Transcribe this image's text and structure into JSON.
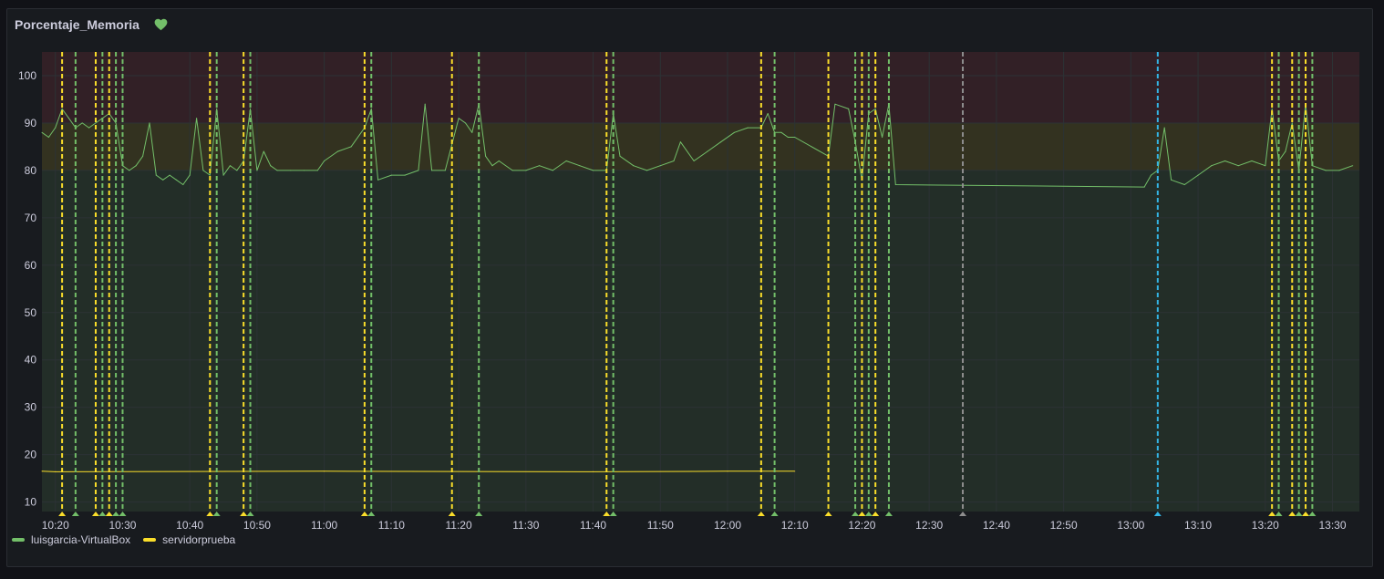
{
  "panel": {
    "title": "Porcentaje_Memoria",
    "health_icon": "heart-icon",
    "health_color": "#73bf69"
  },
  "colors": {
    "background": "#181b1f",
    "grid": "#2c3235",
    "text": "#ccccdc",
    "threshold_green": "#73bf69",
    "threshold_yellow": "#fade2a",
    "threshold_red": "#f2495c",
    "annotation_gray": "#8e8e8e",
    "annotation_blue": "#33b5e5"
  },
  "chart_data": {
    "type": "line",
    "title": "",
    "xlabel": "",
    "ylabel": "",
    "ylim": [
      8,
      105
    ],
    "yticks": [
      10,
      20,
      30,
      40,
      50,
      60,
      70,
      80,
      90,
      100
    ],
    "xlim": [
      "10:18",
      "13:34"
    ],
    "xticks": [
      "10:20",
      "10:30",
      "10:40",
      "10:50",
      "11:00",
      "11:10",
      "11:20",
      "11:30",
      "11:40",
      "11:50",
      "12:00",
      "12:10",
      "12:20",
      "12:30",
      "12:40",
      "12:50",
      "13:00",
      "13:10",
      "13:20",
      "13:30"
    ],
    "grid": true,
    "legend_position": "bottom-left",
    "thresholds": [
      {
        "from": 0,
        "to": 80,
        "color": "#73bf69"
      },
      {
        "from": 80,
        "to": 90,
        "color": "#fade2a"
      },
      {
        "from": 90,
        "to": 105,
        "color": "#f2495c"
      }
    ],
    "series": [
      {
        "name": "luisgarcia-VirtualBox",
        "color": "#73bf69",
        "points": [
          [
            "10:18",
            88
          ],
          [
            "10:19",
            87
          ],
          [
            "10:20",
            89
          ],
          [
            "10:21",
            93
          ],
          [
            "10:22",
            91
          ],
          [
            "10:23",
            89
          ],
          [
            "10:24",
            90
          ],
          [
            "10:25",
            89
          ],
          [
            "10:26",
            90
          ],
          [
            "10:27",
            91
          ],
          [
            "10:28",
            92
          ],
          [
            "10:29",
            90
          ],
          [
            "10:30",
            81
          ],
          [
            "10:31",
            80
          ],
          [
            "10:32",
            81
          ],
          [
            "10:33",
            83
          ],
          [
            "10:34",
            90
          ],
          [
            "10:35",
            79
          ],
          [
            "10:36",
            78
          ],
          [
            "10:37",
            79
          ],
          [
            "10:38",
            78
          ],
          [
            "10:39",
            77
          ],
          [
            "10:40",
            79
          ],
          [
            "10:41",
            91
          ],
          [
            "10:42",
            80
          ],
          [
            "10:43",
            79
          ],
          [
            "10:44",
            93
          ],
          [
            "10:45",
            79
          ],
          [
            "10:46",
            81
          ],
          [
            "10:47",
            80
          ],
          [
            "10:48",
            82
          ],
          [
            "10:49",
            93
          ],
          [
            "10:50",
            80
          ],
          [
            "10:51",
            84
          ],
          [
            "10:52",
            81
          ],
          [
            "10:53",
            80
          ],
          [
            "10:55",
            80
          ],
          [
            "10:57",
            80
          ],
          [
            "10:59",
            80
          ],
          [
            "11:00",
            82
          ],
          [
            "11:02",
            84
          ],
          [
            "11:04",
            85
          ],
          [
            "11:06",
            89
          ],
          [
            "11:07",
            93
          ],
          [
            "11:08",
            78
          ],
          [
            "11:10",
            79
          ],
          [
            "11:12",
            79
          ],
          [
            "11:14",
            80
          ],
          [
            "11:15",
            94
          ],
          [
            "11:16",
            80
          ],
          [
            "11:18",
            80
          ],
          [
            "11:20",
            91
          ],
          [
            "11:21",
            90
          ],
          [
            "11:22",
            88
          ],
          [
            "11:23",
            94
          ],
          [
            "11:24",
            83
          ],
          [
            "11:25",
            81
          ],
          [
            "11:26",
            82
          ],
          [
            "11:28",
            80
          ],
          [
            "11:30",
            80
          ],
          [
            "11:32",
            81
          ],
          [
            "11:34",
            80
          ],
          [
            "11:36",
            82
          ],
          [
            "11:38",
            81
          ],
          [
            "11:40",
            80
          ],
          [
            "11:42",
            80
          ],
          [
            "11:43",
            92
          ],
          [
            "11:44",
            83
          ],
          [
            "11:46",
            81
          ],
          [
            "11:48",
            80
          ],
          [
            "11:50",
            81
          ],
          [
            "11:52",
            82
          ],
          [
            "11:53",
            86
          ],
          [
            "11:55",
            82
          ],
          [
            "11:57",
            84
          ],
          [
            "11:59",
            86
          ],
          [
            "12:01",
            88
          ],
          [
            "12:03",
            89
          ],
          [
            "12:05",
            89
          ],
          [
            "12:06",
            92
          ],
          [
            "12:07",
            88
          ],
          [
            "12:08",
            88
          ],
          [
            "12:09",
            87
          ],
          [
            "12:10",
            87
          ],
          [
            "12:15",
            83
          ],
          [
            "12:16",
            94
          ],
          [
            "12:18",
            93
          ],
          [
            "12:19",
            86
          ],
          [
            "12:20",
            78
          ],
          [
            "12:21",
            92
          ],
          [
            "12:22",
            93
          ],
          [
            "12:23",
            87
          ],
          [
            "12:24",
            94
          ],
          [
            "12:25",
            77
          ],
          [
            "13:02",
            76.5
          ],
          [
            "13:03",
            79
          ],
          [
            "13:04",
            80
          ],
          [
            "13:05",
            89
          ],
          [
            "13:06",
            78
          ],
          [
            "13:08",
            77
          ],
          [
            "13:10",
            79
          ],
          [
            "13:12",
            81
          ],
          [
            "13:14",
            82
          ],
          [
            "13:16",
            81
          ],
          [
            "13:18",
            82
          ],
          [
            "13:20",
            81
          ],
          [
            "13:21",
            93
          ],
          [
            "13:22",
            82
          ],
          [
            "13:23",
            84
          ],
          [
            "13:24",
            90
          ],
          [
            "13:25",
            80
          ],
          [
            "13:26",
            94
          ],
          [
            "13:27",
            81
          ],
          [
            "13:29",
            80
          ],
          [
            "13:31",
            80
          ],
          [
            "13:33",
            81
          ]
        ]
      },
      {
        "name": "servidorprueba",
        "color": "#fade2a",
        "points": [
          [
            "10:18",
            16.5
          ],
          [
            "10:20",
            16.4
          ],
          [
            "11:00",
            16.5
          ],
          [
            "11:40",
            16.4
          ],
          [
            "12:00",
            16.5
          ],
          [
            "12:10",
            16.5
          ]
        ]
      }
    ],
    "annotations": [
      {
        "time": "10:21",
        "color": "#fade2a"
      },
      {
        "time": "10:23",
        "color": "#73bf69"
      },
      {
        "time": "10:26",
        "color": "#fade2a"
      },
      {
        "time": "10:27",
        "color": "#73bf69"
      },
      {
        "time": "10:28",
        "color": "#fade2a"
      },
      {
        "time": "10:29",
        "color": "#73bf69"
      },
      {
        "time": "10:30",
        "color": "#73bf69"
      },
      {
        "time": "10:43",
        "color": "#fade2a"
      },
      {
        "time": "10:44",
        "color": "#73bf69"
      },
      {
        "time": "10:48",
        "color": "#fade2a"
      },
      {
        "time": "10:49",
        "color": "#73bf69"
      },
      {
        "time": "11:06",
        "color": "#fade2a"
      },
      {
        "time": "11:07",
        "color": "#73bf69"
      },
      {
        "time": "11:19",
        "color": "#fade2a"
      },
      {
        "time": "11:23",
        "color": "#73bf69"
      },
      {
        "time": "11:42",
        "color": "#fade2a"
      },
      {
        "time": "11:43",
        "color": "#73bf69"
      },
      {
        "time": "12:05",
        "color": "#fade2a"
      },
      {
        "time": "12:07",
        "color": "#73bf69"
      },
      {
        "time": "12:15",
        "color": "#fade2a"
      },
      {
        "time": "12:19",
        "color": "#73bf69"
      },
      {
        "time": "12:20",
        "color": "#fade2a"
      },
      {
        "time": "12:21",
        "color": "#73bf69"
      },
      {
        "time": "12:22",
        "color": "#fade2a"
      },
      {
        "time": "12:24",
        "color": "#73bf69"
      },
      {
        "time": "12:35",
        "color": "#8e8e8e"
      },
      {
        "time": "13:04",
        "color": "#33b5e5"
      },
      {
        "time": "13:21",
        "color": "#fade2a"
      },
      {
        "time": "13:22",
        "color": "#73bf69"
      },
      {
        "time": "13:24",
        "color": "#fade2a"
      },
      {
        "time": "13:25",
        "color": "#73bf69"
      },
      {
        "time": "13:26",
        "color": "#fade2a"
      },
      {
        "time": "13:27",
        "color": "#73bf69"
      }
    ]
  }
}
